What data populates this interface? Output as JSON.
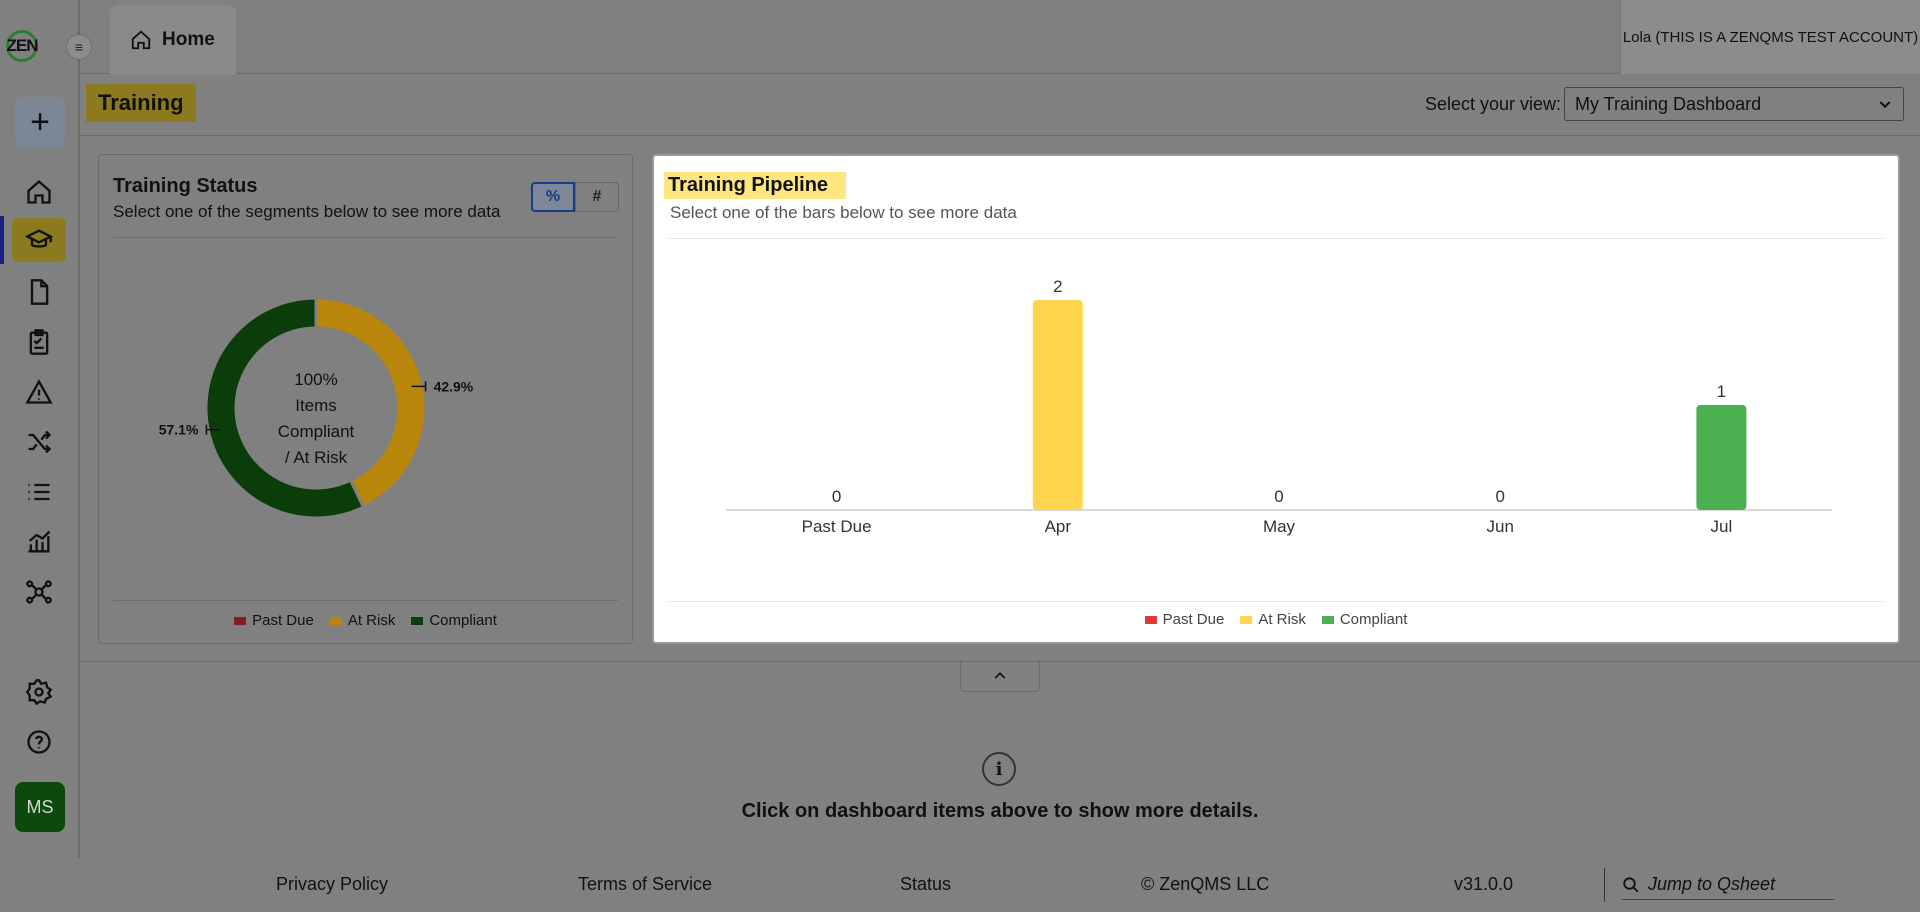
{
  "app": {
    "logo_text": "ZEN",
    "menu_glyph": "≡"
  },
  "tabs": [
    {
      "label": "Home",
      "icon": "home-icon"
    }
  ],
  "user": {
    "name": "Lola (THIS IS A ZENQMS TEST ACCOUNT)"
  },
  "sidebar": {
    "add_label": "+",
    "items": [
      {
        "icon": "home-icon"
      },
      {
        "icon": "graduation-cap-icon",
        "active": true
      },
      {
        "icon": "document-icon"
      },
      {
        "icon": "clipboard-icon"
      },
      {
        "icon": "warning-icon"
      },
      {
        "icon": "shuffle-icon"
      },
      {
        "icon": "list-icon"
      },
      {
        "icon": "analytics-icon"
      },
      {
        "icon": "network-icon"
      },
      {
        "icon": "gear-icon"
      },
      {
        "icon": "help-icon"
      }
    ],
    "avatar_initials": "MS"
  },
  "page": {
    "title": "Training",
    "view_label": "Select your view:",
    "view_selected": "My Training Dashboard"
  },
  "status_card": {
    "title": "Training Status",
    "subtitle": "Select one of the segments below to see more data",
    "toggle": {
      "percent": "%",
      "count": "#"
    },
    "center_lines": [
      "100%",
      "Items",
      "Compliant",
      "/ At Risk"
    ],
    "chart_data": {
      "type": "pie",
      "categories": [
        "Past Due",
        "At Risk",
        "Compliant"
      ],
      "values": [
        0,
        42.9,
        57.1
      ],
      "labels": [
        "",
        "42.9%",
        "57.1%"
      ],
      "colors": [
        "#8b1a1a",
        "#b8860b",
        "#0b3d0b"
      ],
      "legend_position": "bottom"
    },
    "legend": [
      {
        "label": "Past Due",
        "color": "#8b1a1a"
      },
      {
        "label": "At Risk",
        "color": "#b8860b"
      },
      {
        "label": "Compliant",
        "color": "#0b3d0b"
      }
    ]
  },
  "pipeline_card": {
    "title": "Training Pipeline",
    "subtitle": "Select one of the bars below to see more data",
    "chart_data": {
      "type": "bar",
      "categories": [
        "Past Due",
        "Apr",
        "May",
        "Jun",
        "Jul"
      ],
      "values": [
        0,
        2,
        0,
        0,
        1
      ],
      "colors": [
        "#e53935",
        "#ffd54f",
        "#ffd54f",
        "#ffd54f",
        "#4caf50"
      ],
      "ylim": [
        0,
        2
      ],
      "grid": false,
      "legend_position": "bottom"
    },
    "legend": [
      {
        "label": "Past Due",
        "color": "#e53935"
      },
      {
        "label": "At Risk",
        "color": "#ffd54f"
      },
      {
        "label": "Compliant",
        "color": "#4caf50"
      }
    ]
  },
  "details": {
    "message": "Click on dashboard items above to show more details.",
    "info_glyph": "i"
  },
  "footer": {
    "privacy": "Privacy Policy",
    "terms": "Terms of Service",
    "status": "Status",
    "copyright": "© ZenQMS LLC",
    "version": "v31.0.0",
    "search_placeholder": "Jump to Qsheet"
  }
}
